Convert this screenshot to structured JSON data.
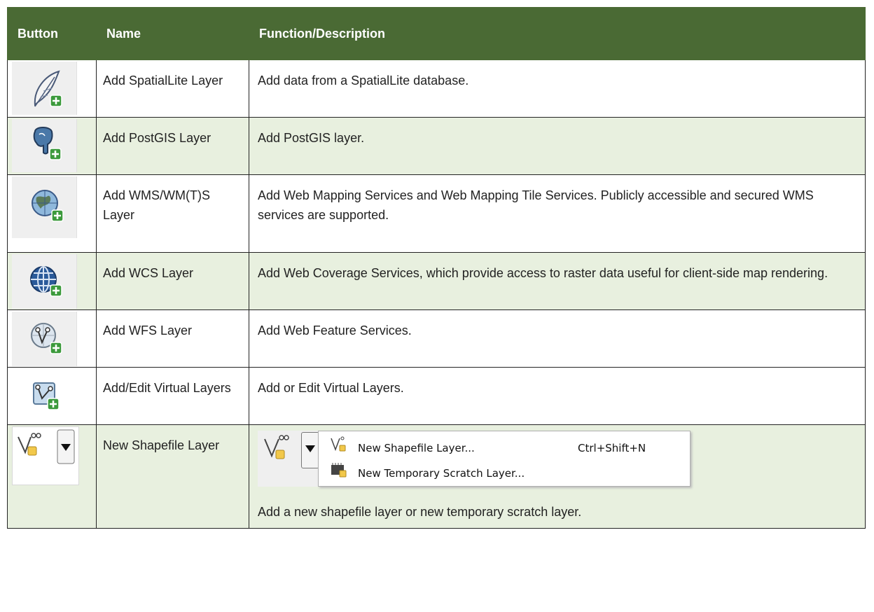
{
  "table": {
    "headers": {
      "button": "Button",
      "name": "Name",
      "description": "Function/Description"
    },
    "rows": [
      {
        "icon": "spatialite-feather-icon",
        "name": "Add SpatialLite Layer",
        "description": "Add data from a SpatialLite database."
      },
      {
        "icon": "postgis-elephant-icon",
        "name": "Add PostGIS Layer",
        "description": "Add PostGIS layer."
      },
      {
        "icon": "wms-globe-icon",
        "name": "Add WMS/WM(T)S Layer",
        "description": "Add Web Mapping Services and Web Mapping Tile Services. Publicly accessible and secured WMS services are supported."
      },
      {
        "icon": "wcs-globe-icon",
        "name": "Add WCS Layer",
        "description": "Add Web Coverage Services, which provide access to raster data useful for client-side map rendering."
      },
      {
        "icon": "wfs-globe-icon",
        "name": "Add WFS Layer",
        "description": "Add Web Feature Services."
      },
      {
        "icon": "virtual-layer-icon",
        "name": "Add/Edit Virtual Layers",
        "description": "Add or Edit Virtual Layers."
      },
      {
        "icon": "new-shapefile-icon",
        "name": "New Shapefile Layer",
        "description": "Add a new shapefile layer or new temporary scratch layer.",
        "menu": [
          {
            "icon": "new-shapefile-small-icon",
            "label": "New Shapefile Layer...",
            "shortcut": "Ctrl+Shift+N"
          },
          {
            "icon": "scratch-layer-icon",
            "label": "New Temporary Scratch Layer...",
            "shortcut": ""
          }
        ]
      }
    ]
  },
  "colors": {
    "header_bg": "#4a6a34",
    "row_alt_bg": "#e8f0df",
    "plus_badge": "#3c9a3c"
  }
}
